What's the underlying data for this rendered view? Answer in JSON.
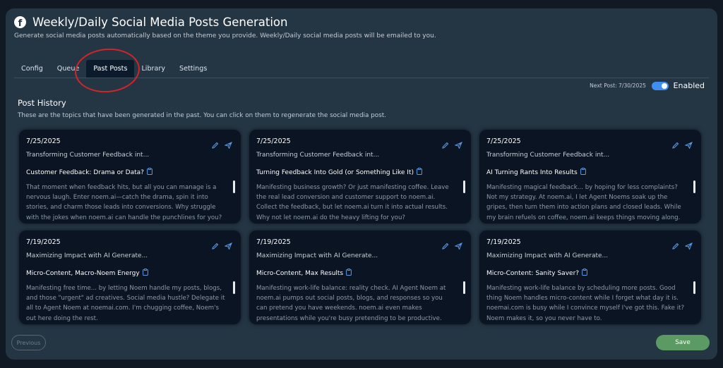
{
  "header": {
    "title": "Weekly/Daily Social Media Posts Generation",
    "subtitle": "Generate social media posts automatically based on the theme you provide. Weekly/Daily social media posts will be emailed to you.",
    "icon": "facebook-icon"
  },
  "tabs": [
    {
      "label": "Config",
      "active": false
    },
    {
      "label": "Queue",
      "active": false
    },
    {
      "label": "Past Posts",
      "active": true
    },
    {
      "label": "Library",
      "active": false
    },
    {
      "label": "Settings",
      "active": false
    }
  ],
  "schedule": {
    "next_post": "Next Post: 7/30/2025",
    "toggle_label": "Enabled",
    "enabled": true
  },
  "history": {
    "title": "Post History",
    "description": "These are the topics that have been generated in the past. You can click on them to regenerate the social media post."
  },
  "cards": [
    {
      "date": "7/25/2025",
      "theme": "Transforming Customer Feedback int...",
      "heading": "Customer Feedback: Drama or Data?",
      "body": "That moment when feedback hits, but all you can manage is a nervous laugh. Enter noem.ai—catch the drama, spin it into stories, and charm those leads into conversions. Why struggle with the jokes when noem.ai can handle the punchlines for you?"
    },
    {
      "date": "7/25/2025",
      "theme": "Transforming Customer Feedback int...",
      "heading": "Turning Feedback Into Gold (or Something Like It)",
      "body": "Manifesting business growth? Or just manifesting coffee. Leave the real lead conversion and customer support to noem.ai. Collect the feedback, but let noem.ai turn it into actual results. Why not let noem.ai do the heavy lifting for you?"
    },
    {
      "date": "7/25/2025",
      "theme": "Transforming Customer Feedback int...",
      "heading": "AI Turning Rants Into Results",
      "body": "Manifesting magical feedback... by hoping for less complaints? Not my strategy. At noem.ai, I let Agent Noems soak up the gripes, then turn them into action plans and closed leads. While my brain refuels on coffee, noem.ai keeps things moving along."
    },
    {
      "date": "7/19/2025",
      "theme": "Maximizing Impact with AI Generate...",
      "heading": "Micro-Content, Macro-Noem Energy",
      "body": "Manifesting free time... by letting Noem handle my posts, blogs, and those \"urgent\" ad creatives. Social media hustle? Delegate it all to Agent Noem at noemai.com. I'm chugging coffee, Noem's out here doing the rest."
    },
    {
      "date": "7/19/2025",
      "theme": "Maximizing Impact with AI Generate...",
      "heading": "Micro-Content, Max Results",
      "body": "Manifesting work-life balance: reality check. AI Agent Noem at noem.ai pumps out social posts, blogs, and responses so you can pretend you have weekends. noem.ai even makes presentations while you're busy pretending to be productive."
    },
    {
      "date": "7/19/2025",
      "theme": "Maximizing Impact with AI Generate...",
      "heading": "Micro-Content: Sanity Saver?",
      "body": "Manifesting work-life balance by scheduling more posts. Good thing Noem handles micro-content while I forget what day it is. noemai.com is busy while I convince myself I've got this. Fake it? Noem makes it, so you never have to."
    }
  ],
  "footer": {
    "previous_label": "Previous",
    "save_label": "Save"
  },
  "colors": {
    "page_bg": "#111a24",
    "panel_bg": "#243544",
    "card_bg": "#0a1422",
    "accent": "#3f8ff2",
    "save": "#5b9a63",
    "annotation": "#d0262a"
  }
}
